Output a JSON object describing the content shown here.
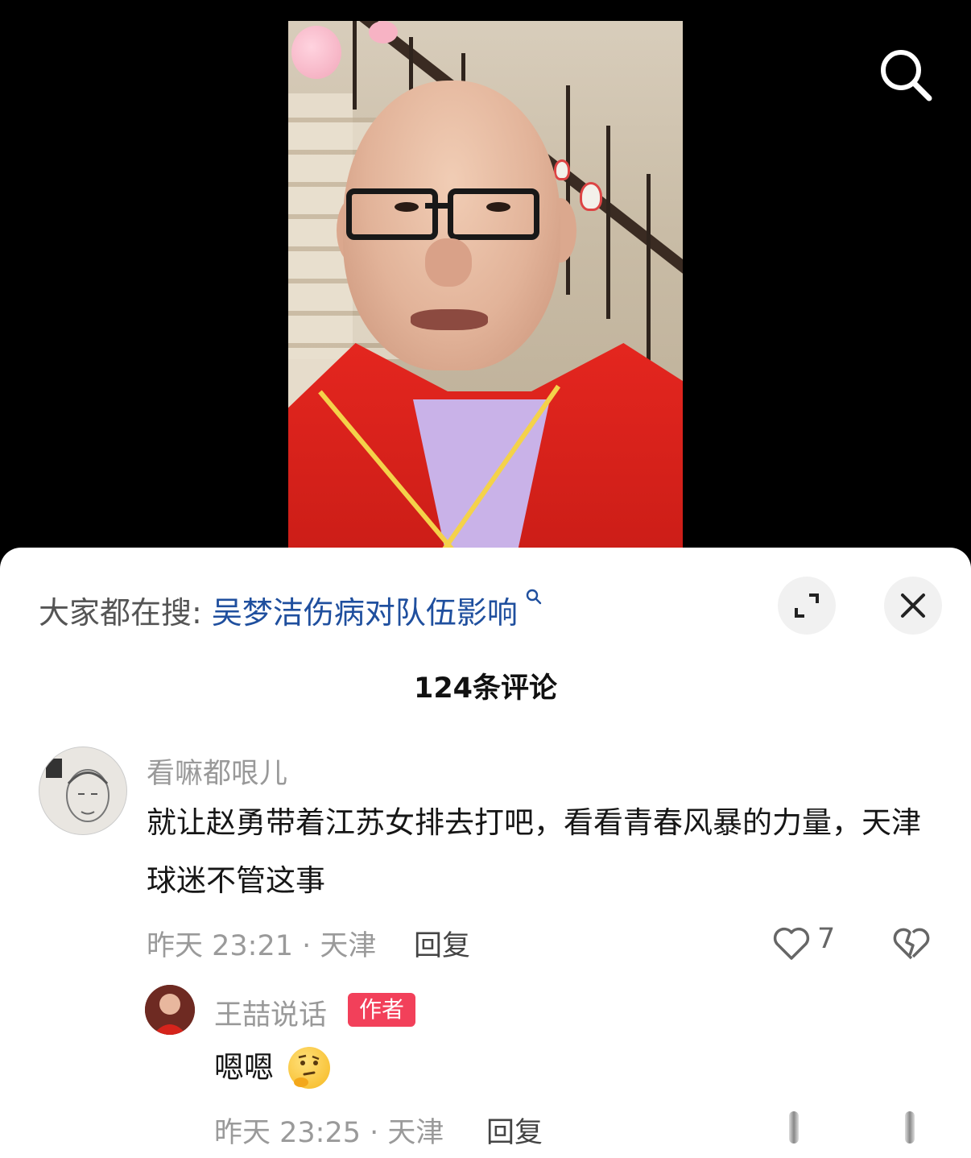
{
  "search_bar": {
    "label": "大家都在搜:",
    "query": "吴梦洁伤病对队伍影响",
    "icon": "search-icon"
  },
  "header": {
    "comment_count": "124条评论"
  },
  "comments": [
    {
      "username": "看嘛都哏儿",
      "text": "就让赵勇带着江苏女排去打吧，看看青春风暴的力量，天津球迷不管这事",
      "time_location": "昨天 23:21 · 天津",
      "reply_label": "回复",
      "like_count": "7",
      "replies": [
        {
          "username": "王喆说话",
          "badge": "作者",
          "text": "嗯嗯",
          "emoji": "thinking-face-emoji",
          "time_location": "昨天 23:25 · 天津",
          "reply_label": "回复"
        }
      ]
    }
  ],
  "colors": {
    "link": "#1f4f9e",
    "author_badge": "#f2405a",
    "sheet_bg": "#ffffff"
  }
}
